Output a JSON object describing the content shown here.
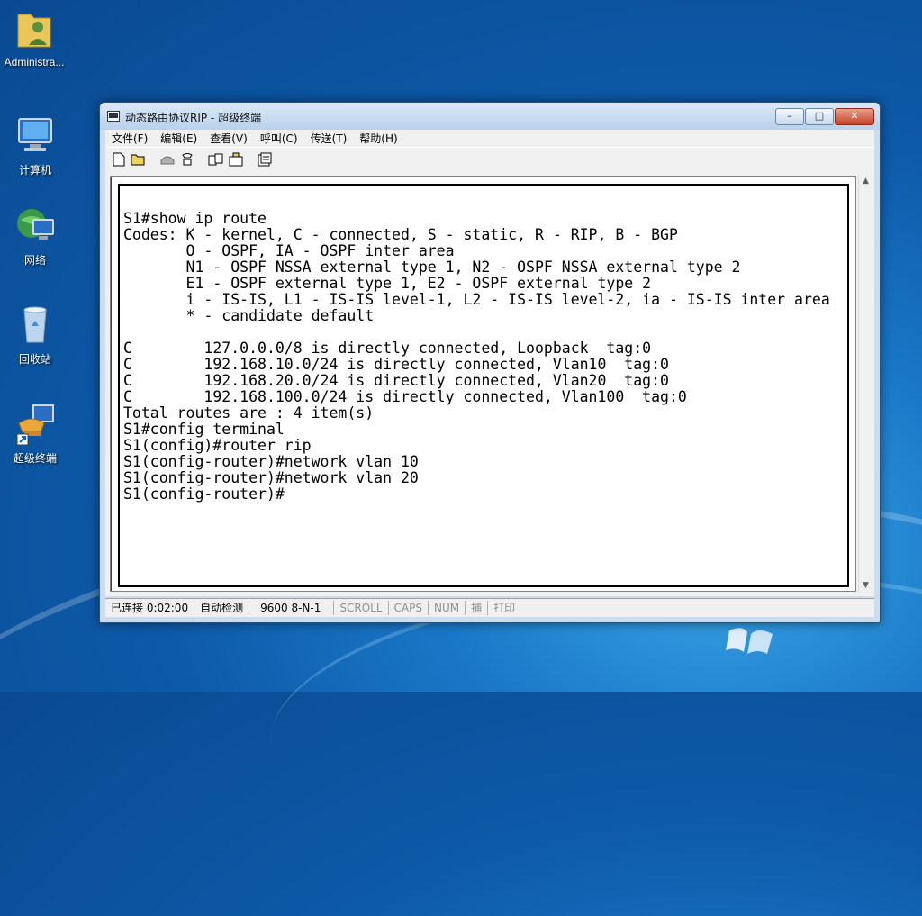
{
  "desktop": {
    "icons": [
      {
        "label": "Administra..."
      },
      {
        "label": "计算机"
      },
      {
        "label": "网络"
      },
      {
        "label": "回收站"
      },
      {
        "label": "超级终端"
      }
    ]
  },
  "window": {
    "title": "动态路由协议RIP - 超级终端",
    "controls": {
      "minimize": "–",
      "maximize": "□",
      "close": "✕"
    },
    "menu": [
      "文件(F)",
      "编辑(E)",
      "查看(V)",
      "呼叫(C)",
      "传送(T)",
      "帮助(H)"
    ],
    "toolbar": [
      "new-icon",
      "open-icon",
      "disconnect-icon",
      "call-icon",
      "send-icon",
      "receive-icon",
      "properties-icon"
    ]
  },
  "terminal": {
    "lines": [
      "S1#show ip route",
      "Codes: K - kernel, C - connected, S - static, R - RIP, B - BGP",
      "       O - OSPF, IA - OSPF inter area",
      "       N1 - OSPF NSSA external type 1, N2 - OSPF NSSA external type 2",
      "       E1 - OSPF external type 1, E2 - OSPF external type 2",
      "       i - IS-IS, L1 - IS-IS level-1, L2 - IS-IS level-2, ia - IS-IS inter area",
      "       * - candidate default",
      "",
      "C        127.0.0.0/8 is directly connected, Loopback  tag:0",
      "C        192.168.10.0/24 is directly connected, Vlan10  tag:0",
      "C        192.168.20.0/24 is directly connected, Vlan20  tag:0",
      "C        192.168.100.0/24 is directly connected, Vlan100  tag:0",
      "Total routes are : 4 item(s)",
      "S1#config terminal",
      "S1(config)#router rip",
      "S1(config-router)#network vlan 10",
      "S1(config-router)#network vlan 20",
      "S1(config-router)#"
    ]
  },
  "status": {
    "connected": "已连接 0:02:00",
    "detect": "自动检测",
    "settings": "9600 8-N-1",
    "scroll": "SCROLL",
    "caps": "CAPS",
    "num": "NUM",
    "capture": "捕",
    "print": "打印"
  }
}
